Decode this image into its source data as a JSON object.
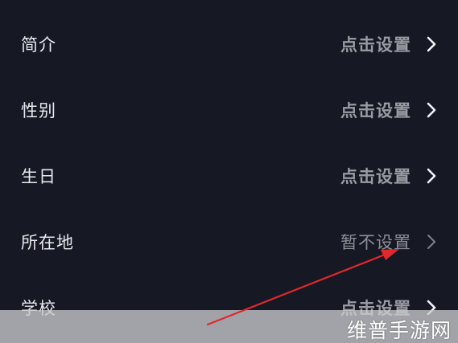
{
  "settings": {
    "rows": [
      {
        "label": "简介",
        "value": "点击设置"
      },
      {
        "label": "性别",
        "value": "点击设置"
      },
      {
        "label": "生日",
        "value": "点击设置"
      },
      {
        "label": "所在地",
        "value": "暂不设置"
      },
      {
        "label": "学校",
        "value": "点击设置"
      }
    ]
  },
  "watermark": {
    "text": "维普手游网"
  },
  "colors": {
    "background": "#161823",
    "label": "#e9e9ee",
    "value": "#9a9ba2",
    "annotation_arrow": "#e0282d"
  },
  "icons": {
    "chevron": "chevron-right-icon",
    "annotation": "red-arrow-annotation"
  }
}
